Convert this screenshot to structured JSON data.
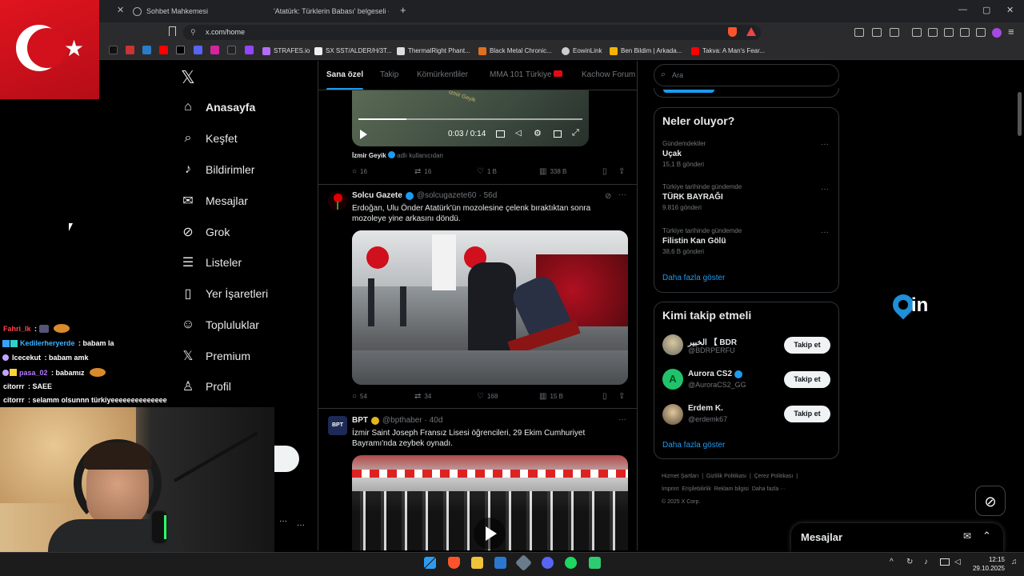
{
  "browser": {
    "tabs": [
      {
        "title": "Sohbet Mahkemesi"
      },
      {
        "title": "'Atatürk: Türklerin Babası' belgeseli -"
      }
    ],
    "new_tab": "+",
    "url": "x.com/home",
    "window_controls": [
      "—",
      "▢",
      "✕"
    ],
    "bookmarks": [
      {
        "label": "STRAFES.io"
      },
      {
        "label": "SX SST/ALDER/H/3T..."
      },
      {
        "label": "ThermalRight Phant..."
      },
      {
        "label": "Black Metal Chronic..."
      },
      {
        "label": "EowinLink"
      },
      {
        "label": "Ben Bildim | Arkada..."
      },
      {
        "label": "Takva: A Man's Fear..."
      }
    ]
  },
  "nav": {
    "items": [
      {
        "label": "Anasayfa",
        "icon": "home-icon"
      },
      {
        "label": "Keşfet",
        "icon": "search-icon"
      },
      {
        "label": "Bildirimler",
        "icon": "bell-icon"
      },
      {
        "label": "Mesajlar",
        "icon": "envelope-icon"
      },
      {
        "label": "Grok",
        "icon": "grok-icon"
      },
      {
        "label": "Listeler",
        "icon": "list-icon"
      },
      {
        "label": "Yer İşaretleri",
        "icon": "bookmark-icon"
      },
      {
        "label": "Topluluklar",
        "icon": "people-icon"
      },
      {
        "label": "Premium",
        "icon": "x-logo-icon"
      },
      {
        "label": "Profil",
        "icon": "person-icon"
      }
    ],
    "more": "···"
  },
  "feed": {
    "tabs": [
      "Sana özel",
      "Takip",
      "Kömürkentliler",
      "MMA 101 Türkiye",
      "Kachow Forum"
    ],
    "tweet1": {
      "video_time": "0:03 / 0:14",
      "video_overlay_text": "İzmir Geyik",
      "author": "İzmir Geyik",
      "by_label": "adlı kullanıcıdan",
      "replies": "16",
      "retweets": "16",
      "likes": "1 B",
      "views": "338 B"
    },
    "tweet2": {
      "name": "Solcu Gazete",
      "handle": "@solcugazete60",
      "age": "· 56d",
      "text": "Erdoğan, Ulu Önder Atatürk'ün mozolesine çelenk bıraktıktan sonra mozoleye yine arkasını döndü.",
      "replies": "54",
      "retweets": "34",
      "likes": "168",
      "views": "15 B"
    },
    "tweet3": {
      "name": "BPT",
      "handle": "@bpthaber",
      "age": "· 40d",
      "avatar_text": "BPT",
      "text": "İzmir Saint Joseph Fransız Lisesi öğrencileri, 29 Ekim Cumhuriyet Bayramı'nda zeybek oynadı."
    }
  },
  "right": {
    "search_placeholder": "Ara",
    "trends_title": "Neler oluyor?",
    "trends": [
      {
        "meta": "Gündemdekiler",
        "name": "Uçak",
        "count": "15,1 B gönderi"
      },
      {
        "meta": "Türkiye tarihinde gündemde",
        "name": "TÜRK BAYRAĞI",
        "count": "9.816 gönderi"
      },
      {
        "meta": "Türkiye tarihinde gündemde",
        "name": "Filistin Kan Gölü",
        "count": "38,6 B gönderi"
      }
    ],
    "show_more": "Daha fazla göster",
    "follow_title": "Kimi takip etmeli",
    "follows": [
      {
        "name": "الخبير 【 BDR",
        "handle": "@BDRPERFU"
      },
      {
        "name": "Aurora CS2",
        "handle": "@AuroraCS2_GG"
      },
      {
        "name": "Erdem K.",
        "handle": "@erdemk67"
      }
    ],
    "follow_label": "Takip et",
    "footer": [
      "Hizmet Şartları",
      "|",
      "Gizlilik Politikası",
      "|",
      "Çerez Politikası",
      "|",
      "İmprint",
      "Erişilebilirlik",
      "Reklam bilgisi",
      "Daha fazla ···",
      "© 2025 X Corp."
    ],
    "messages": "Mesajlar"
  },
  "chat": [
    {
      "user": "Fahri_Ik",
      "msg": ""
    },
    {
      "user": "Kedilerheryerde",
      "msg": "babam la"
    },
    {
      "user": "Icecekut",
      "msg": "babam amk"
    },
    {
      "user": "pasa_02",
      "msg": "babamız"
    },
    {
      "user": "citorrr",
      "msg": "SAEE"
    },
    {
      "user": "citorrr",
      "msg": "selamm olsunnn türkiyeeeeeeeeeeeeee"
    }
  ],
  "taskbar": {
    "time": "12:15",
    "date": "29.10.2025"
  },
  "colors": {
    "accent": "#1d9bf0",
    "bg": "#000000",
    "border": "#2f3336",
    "muted": "#71767b"
  }
}
